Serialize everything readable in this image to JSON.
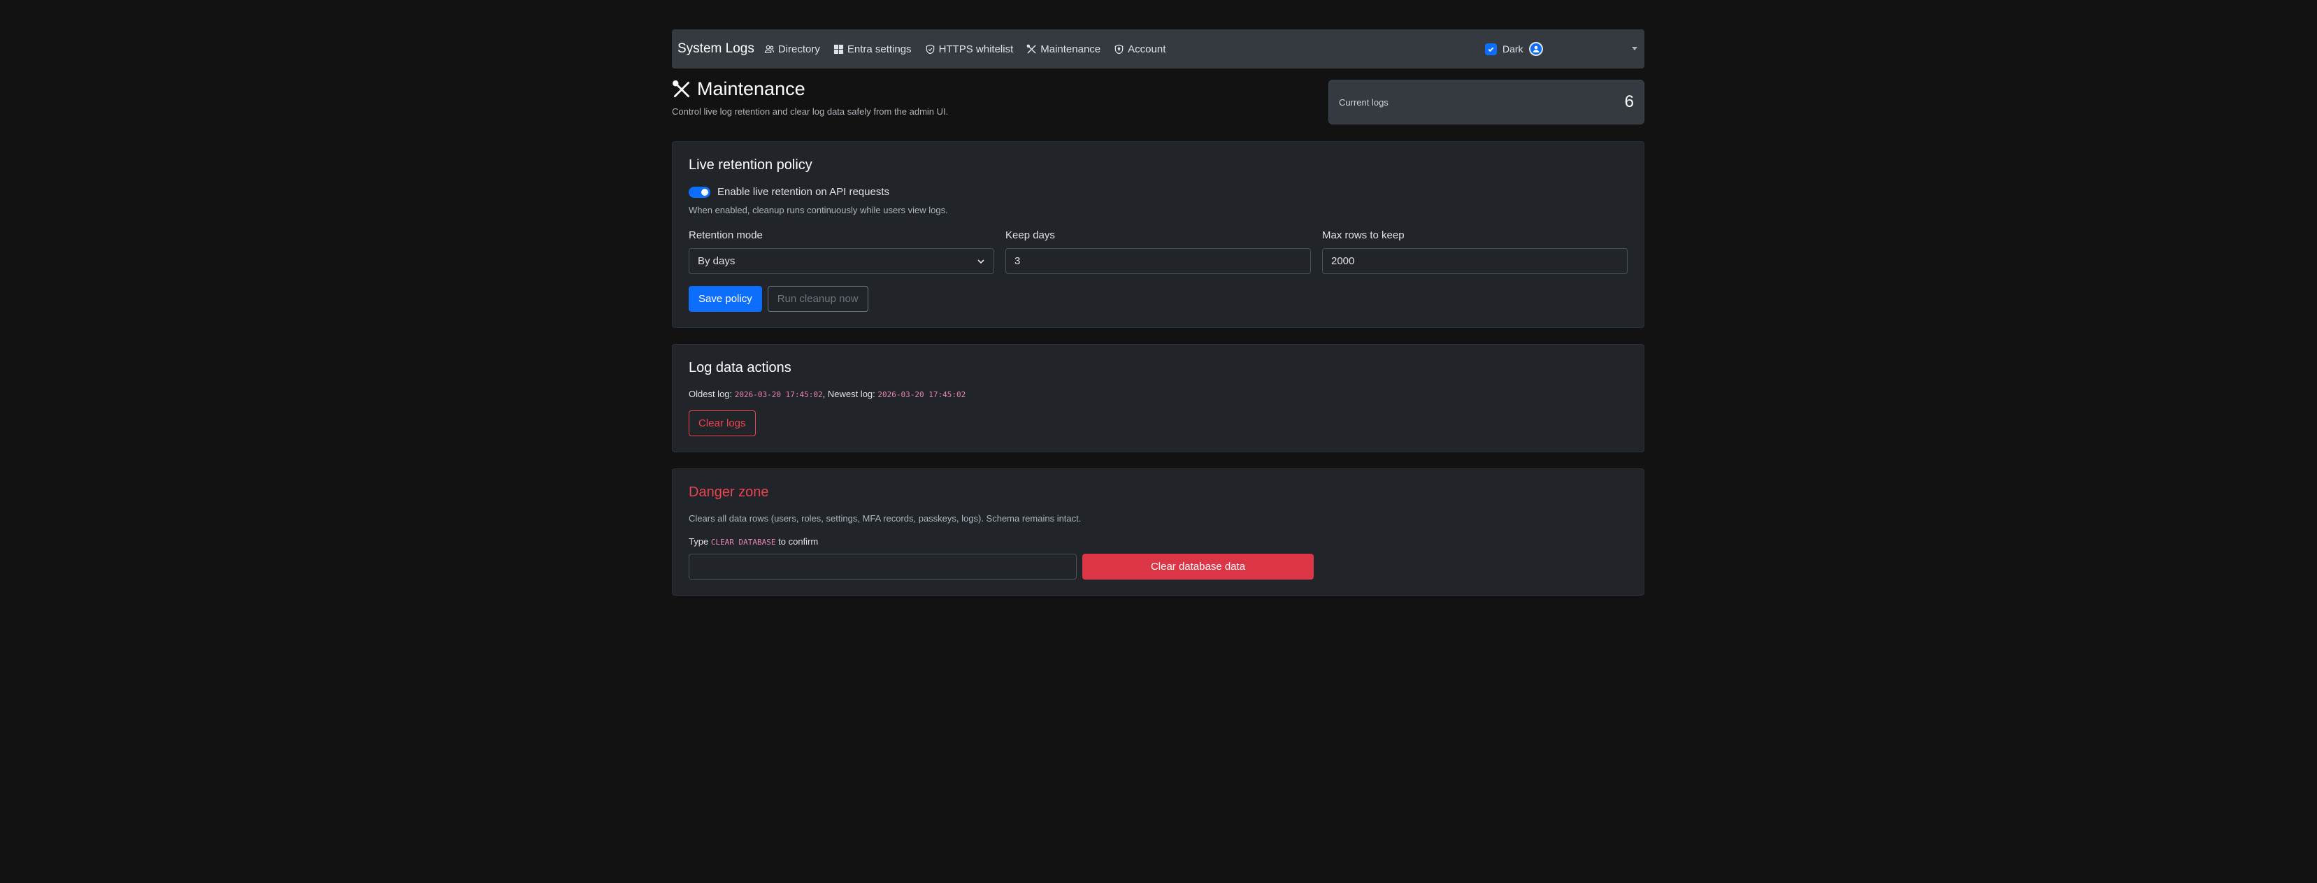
{
  "navbar": {
    "brand": "System Logs",
    "items": [
      {
        "label": "Directory",
        "icon": "people-icon"
      },
      {
        "label": "Entra settings",
        "icon": "windows-icon"
      },
      {
        "label": "HTTPS whitelist",
        "icon": "shield-check-icon"
      },
      {
        "label": "Maintenance",
        "icon": "tools-icon"
      },
      {
        "label": "Account",
        "icon": "shield-lock-icon"
      }
    ],
    "theme_label": "Dark",
    "theme_checked": true
  },
  "header": {
    "title": "Maintenance",
    "subtitle": "Control live log retention and clear log data safely from the admin UI.",
    "stat_label": "Current logs",
    "stat_value": "6"
  },
  "retention": {
    "title": "Live retention policy",
    "toggle_label": "Enable live retention on API requests",
    "toggle_on": true,
    "help": "When enabled, cleanup runs continuously while users view logs.",
    "mode_label": "Retention mode",
    "mode_value": "By days",
    "keep_days_label": "Keep days",
    "keep_days_value": "3",
    "max_rows_label": "Max rows to keep",
    "max_rows_value": "2000",
    "save_label": "Save policy",
    "cleanup_label": "Run cleanup now"
  },
  "log_actions": {
    "title": "Log data actions",
    "oldest_prefix": "Oldest log:",
    "oldest_value": "2026-03-20 17:45:02",
    "newest_prefix": ", Newest log:",
    "newest_value": "2026-03-20 17:45:02",
    "clear_label": "Clear logs"
  },
  "danger": {
    "title": "Danger zone",
    "description": "Clears all data rows (users, roles, settings, MFA records, passkeys, logs). Schema remains intact.",
    "type_prefix": "Type",
    "confirm_phrase": "CLEAR DATABASE",
    "type_suffix": "to confirm",
    "input_value": "",
    "button_label": "Clear database data"
  },
  "colors": {
    "accent": "#0d6efd",
    "danger": "#dc3545",
    "background": "#121212",
    "card": "#212529"
  }
}
